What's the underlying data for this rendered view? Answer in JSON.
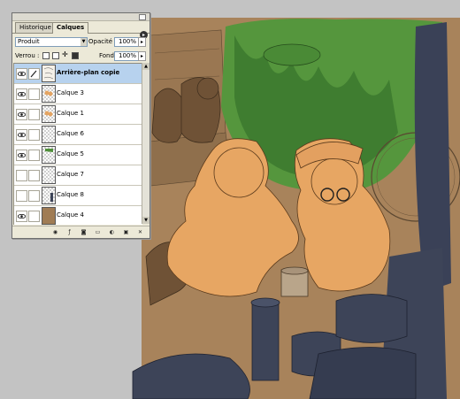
{
  "panel": {
    "tabs": [
      {
        "label": "Historique",
        "active": false
      },
      {
        "label": "Calques",
        "active": true
      }
    ],
    "blend_mode": "Produit",
    "opacity_label": "Opacité :",
    "opacity_value": "100%",
    "lock_label": "Verrou :",
    "fill_label": "Fond :",
    "fill_value": "100%"
  },
  "layers": [
    {
      "name": "Arrière-plan copie",
      "visible": true,
      "selected": true,
      "thumb": "sketch"
    },
    {
      "name": "Calque 3",
      "visible": true,
      "selected": false,
      "thumb": "figures"
    },
    {
      "name": "Calque 1",
      "visible": true,
      "selected": false,
      "thumb": "figures"
    },
    {
      "name": "Calque 6",
      "visible": true,
      "selected": false,
      "thumb": "transparent"
    },
    {
      "name": "Calque 5",
      "visible": true,
      "selected": false,
      "thumb": "plants"
    },
    {
      "name": "Calque 7",
      "visible": false,
      "selected": false,
      "thumb": "transparent"
    },
    {
      "name": "Calque 8",
      "visible": false,
      "selected": false,
      "thumb": "props"
    },
    {
      "name": "Calque 4",
      "visible": true,
      "selected": false,
      "thumb": "brown"
    }
  ],
  "footer_icons": [
    "link-layers-icon",
    "layer-style-icon",
    "layer-mask-icon",
    "new-set-icon",
    "adjustment-layer-icon",
    "new-layer-icon",
    "delete-layer-icon"
  ],
  "colors": {
    "background_fill": "#a07c55",
    "children_fill": "#e4a462",
    "plants_fill": "#4f8f3a",
    "props_fill": "#3d4458",
    "canvas_gray": "#c3c3c3"
  }
}
